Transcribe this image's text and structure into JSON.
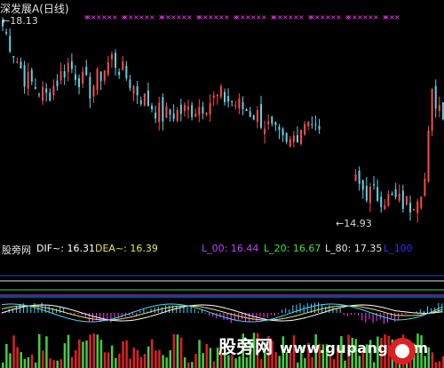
{
  "app": {
    "title": "深发展A(日线)",
    "hi_label": "←18.13",
    "lo_label": "←14.93"
  },
  "indicator": {
    "name": "股旁网",
    "dif": "DIF~: 16.31",
    "dea": "DEA~: 16.39",
    "l00": "L_00: 16.44",
    "l20": "L_20: 16.67",
    "l80": "L_80: 17.35",
    "l100": "L_100"
  },
  "watermark": {
    "cn": "股旁网",
    "url": "www.gupang.com"
  },
  "colors": {
    "background": "#000000",
    "up": "#ff4a4a",
    "down": "#5fd2e6",
    "dea_cyan": "#4ad4ff",
    "dif_text": "#ffffff",
    "dea_text": "#e6e65a",
    "l00": "#c040ff",
    "l20": "#40e040",
    "l80": "#e6e6e6",
    "l100": "#3030ff",
    "marker": "#ff40ff",
    "vol_up": "#e02020",
    "vol_down": "#40d040"
  },
  "chart_data": {
    "type": "candlestick",
    "title": "深发展A(日线)",
    "price_range": [
      14.93,
      18.13
    ],
    "max_price": 18.13,
    "min_price": 14.93,
    "last_dif": 16.31,
    "last_dea": 16.39,
    "l_00": 16.44,
    "l_20": 16.67,
    "l_80": 17.35
  }
}
